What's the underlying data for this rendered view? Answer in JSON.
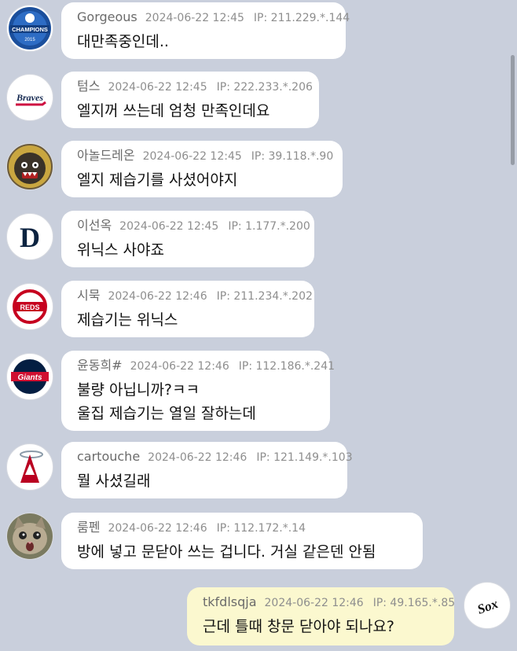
{
  "messages": [
    {
      "nick": "Gorgeous",
      "time": "2024-06-22 12:45",
      "ip": "IP: 211.229.*.144",
      "lines": [
        "대만족중인데.."
      ],
      "avatar": "champions-2015-logo"
    },
    {
      "nick": "텀스",
      "time": "2024-06-22 12:45",
      "ip": "IP: 222.233.*.206",
      "lines": [
        "엘지꺼 쓰는데 엄청 만족인데요"
      ],
      "avatar": "braves-logo"
    },
    {
      "nick": "아놀드레온",
      "time": "2024-06-22 12:45",
      "ip": "IP: 39.118.*.90",
      "lines": [
        "엘지 제습기를 사셨어야지"
      ],
      "avatar": "character-avatar"
    },
    {
      "nick": "이선옥",
      "time": "2024-06-22 12:45",
      "ip": "IP: 1.177.*.200",
      "lines": [
        "위닉스 사야죠"
      ],
      "avatar": "tigers-d-logo"
    },
    {
      "nick": "시묵",
      "time": "2024-06-22 12:46",
      "ip": "IP: 211.234.*.202",
      "lines": [
        "제습기는 위닉스"
      ],
      "avatar": "reds-logo"
    },
    {
      "nick": "윤동희#",
      "time": "2024-06-22 12:46",
      "ip": "IP: 112.186.*.241",
      "lines": [
        "불량 아닙니까?ㅋㅋ",
        "울집 제습기는 열일 잘하는데"
      ],
      "avatar": "giants-logo"
    },
    {
      "nick": "cartouche",
      "time": "2024-06-22 12:46",
      "ip": "IP: 121.149.*.103",
      "lines": [
        "뭘 사셨길래"
      ],
      "avatar": "angels-logo"
    },
    {
      "nick": "룸펜",
      "time": "2024-06-22 12:46",
      "ip": "IP: 112.172.*.14",
      "lines": [
        "방에 넣고 문닫아 쓰는 겁니다. 거실 같은덴 안됨"
      ],
      "avatar": "cat-photo"
    },
    {
      "nick": "tkfdlsqja",
      "time": "2024-06-22 12:46",
      "ip": "IP: 49.165.*.85",
      "lines": [
        "근데 틀때 창문 닫아야 되나요?"
      ],
      "avatar": "white-sox-logo",
      "mine": true
    }
  ],
  "logos": {
    "champions": "CHAMPIONS",
    "champions_year": "2015",
    "braves": "Braves",
    "tigers": "D",
    "reds": "REDS",
    "giants": "Giants",
    "angels": "A",
    "sox": "Sox"
  },
  "colors": {
    "background": "#c9cfdc",
    "bubble": "#ffffff",
    "my_bubble": "#fbf8cf"
  }
}
